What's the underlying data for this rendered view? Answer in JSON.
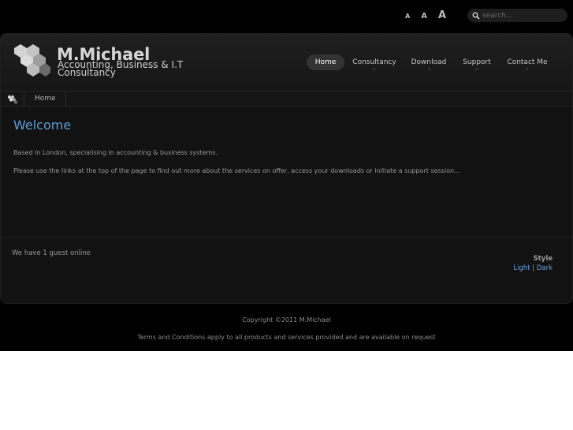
{
  "topbar": {
    "font_sizes": [
      "A",
      "A",
      "A"
    ],
    "search_placeholder": "search..."
  },
  "brand": {
    "name": "M.Michael",
    "tagline": "Accounting, Business & I.T Consultancy"
  },
  "nav": {
    "items": [
      {
        "label": "Home",
        "active": true
      },
      {
        "label": "Consultancy",
        "active": false
      },
      {
        "label": "Download",
        "active": false
      },
      {
        "label": "Support",
        "active": false
      },
      {
        "label": "Contact Me",
        "active": false
      }
    ]
  },
  "breadcrumb": {
    "home": "Home"
  },
  "content": {
    "title": "Welcome",
    "paragraphs": [
      "Based in London, specialising in accounting & business systems.",
      "Please use the links at the top of the page to find out more about the services on offer, access your downloads or initiate a support session..."
    ]
  },
  "footer": {
    "online": "We have 1 guest online",
    "style_label": "Style",
    "style_light": "Light",
    "style_sep": "|",
    "style_dark": "Dark",
    "copyright": "Copyright ©2011 M.Michael",
    "terms": "Terms and Conditions apply to all products and services provided and are available on request"
  },
  "colors": {
    "accent": "#5c9fd8",
    "background": "#000000",
    "panel": "#121212"
  }
}
